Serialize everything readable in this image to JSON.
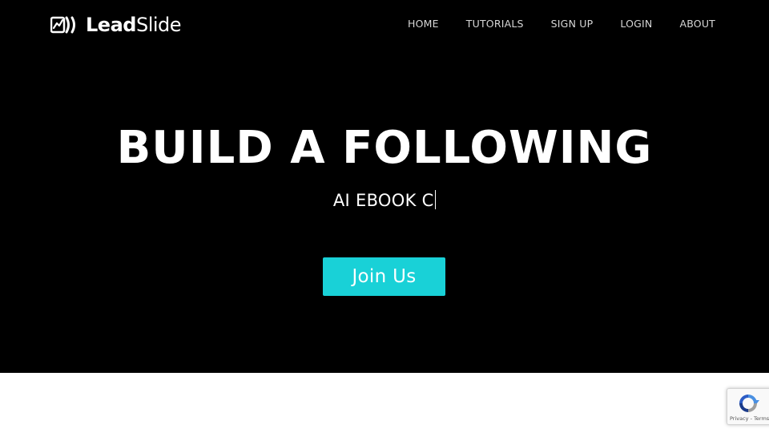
{
  "nav": {
    "logo": {
      "icon": "leadslide-logo-icon",
      "text_bold": "Lead",
      "text_regular": "Slide"
    },
    "items": [
      {
        "label": "HOME"
      },
      {
        "label": "TUTORIALS"
      },
      {
        "label": "SIGN UP"
      },
      {
        "label": "LOGIN"
      },
      {
        "label": "ABOUT"
      }
    ]
  },
  "hero": {
    "headline": "BUILD A FOLLOWING",
    "typed_text": "AI EBOOK C",
    "cta_label": "Join Us",
    "background_color": "#000000",
    "cta_color": "#19d1d7"
  },
  "recaptcha": {
    "icon": "recaptcha-icon",
    "privacy_label": "Privacy",
    "separator": " - ",
    "terms_label": "Terms"
  }
}
